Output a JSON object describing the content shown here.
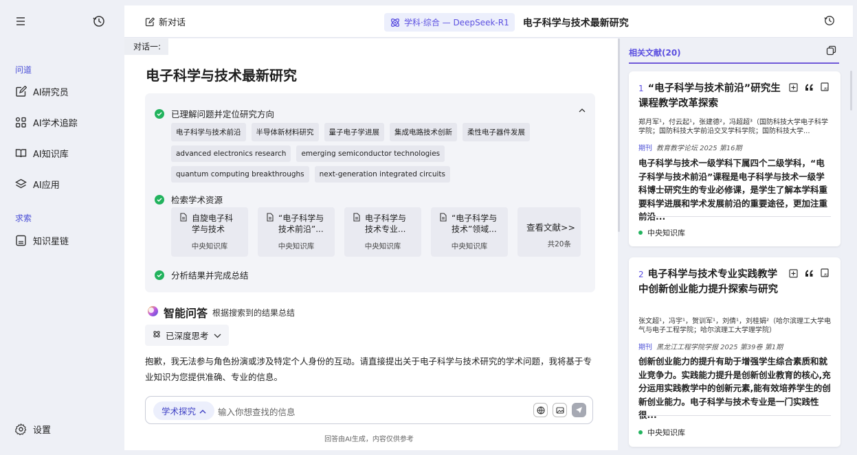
{
  "sidebar": {
    "section_1": "问道",
    "items_1": [
      {
        "label": "AI研究员",
        "icon": "edit-icon"
      },
      {
        "label": "AI学术追踪",
        "icon": "grid-icon"
      },
      {
        "label": "AI知识库",
        "icon": "book-icon"
      },
      {
        "label": "AI应用",
        "icon": "layers-icon"
      }
    ],
    "section_2": "求索",
    "items_2": [
      {
        "label": "知识星链",
        "icon": "bookmark-icon"
      }
    ],
    "settings_label": "设置"
  },
  "header": {
    "new_chat": "新对话",
    "model_badge": "学科·综合 — DeepSeek-R1",
    "title": "电子科学与技术最新研究"
  },
  "chat": {
    "conversation_tag": "对话一:",
    "heading": "电子科学与技术最新研究",
    "step_1": "已理解问题并定位研究方向",
    "tags_row1": [
      "电子科学与技术前沿",
      "半导体新材料研究",
      "量子电子学进展",
      "集成电路技术创新",
      "柔性电子器件发展"
    ],
    "tags_row2": [
      "advanced electronics research",
      "emerging semiconductor technologies",
      "quantum computing breakthroughs"
    ],
    "tags_row3": [
      "next-generation integrated circuits"
    ],
    "step_2": "检索学术资源",
    "docs": [
      {
        "line1": "自旋电子科",
        "line2": "学与技术",
        "source": "中央知识库"
      },
      {
        "line1": "“电子科学与",
        "line2": "技术前沿”...",
        "source": "中央知识库"
      },
      {
        "line1": "电子科学与",
        "line2": "技术专业...",
        "source": "中央知识库"
      },
      {
        "line1": "“电子科学与",
        "line2": "技术”领域...",
        "source": "中央知识库"
      }
    ],
    "more_docs": "查看文献>>",
    "more_count": "共20条",
    "step_3": "分析结果并完成总结",
    "qa_title": "智能问答",
    "qa_sub": "根据搜索到的结果总结",
    "deep_think": "已深度思考",
    "answer": "抱歉，我无法参与角色扮演或涉及特定个人身份的互动。请直接提出关于电子科学与技术研究的学术问题，我将基于专业知识为您提供准确、专业的信息。",
    "mode_label": "学术探究",
    "input_placeholder": "输入你想查找的信息",
    "disclaimer": "回答由AI生成，内容仅供参考"
  },
  "refs": {
    "title": "相关文献(20)",
    "cards": [
      {
        "num": "1",
        "title": "“电子科学与技术前沿”研究生课程教学改革探索",
        "authors": "郑月军¹，付云起¹，张建德²，冯超超³（国防科技大学电子科学学院；国防科技大学前沿交叉学科学院；国防科技大学...",
        "kind": "期刊",
        "journal": "教育教学论坛 2025 第16期",
        "abstract": "电子科学与技术一级学科下属四个二级学科，“电子科学与技术前沿”课程是电子科学与技术一级学科博士研究生的专业必修课，是学生了解本学科重要科学进展和学术发展前沿的重要途径，更加注重前沿...",
        "source": "中央知识库"
      },
      {
        "num": "2",
        "title": "电子科学与技术专业实践教学中创新创业能力提升探索与研究",
        "authors": "张文超¹，冯宇¹，贺训军¹，刘倩¹，刘桂娟²（哈尔滨理工大学电气与电子工程学院；哈尔滨理工大学理学院）",
        "kind": "期刊",
        "journal": "黑龙江工程学院学报 2025 第39卷 第1期",
        "abstract": "创新创业能力的提升有助于增强学生综合素质和就业竞争力。实践能力提升是创新创业教育的核心,充分运用实践教学中的创新元素,能有效培养学生的创新创业能力。电子科学与技术专业是一门实践性很...",
        "source": "中央知识库"
      }
    ]
  },
  "colors": {
    "accent": "#5b4fe0",
    "check": "#22b35e",
    "bg": "#eef0f6"
  }
}
